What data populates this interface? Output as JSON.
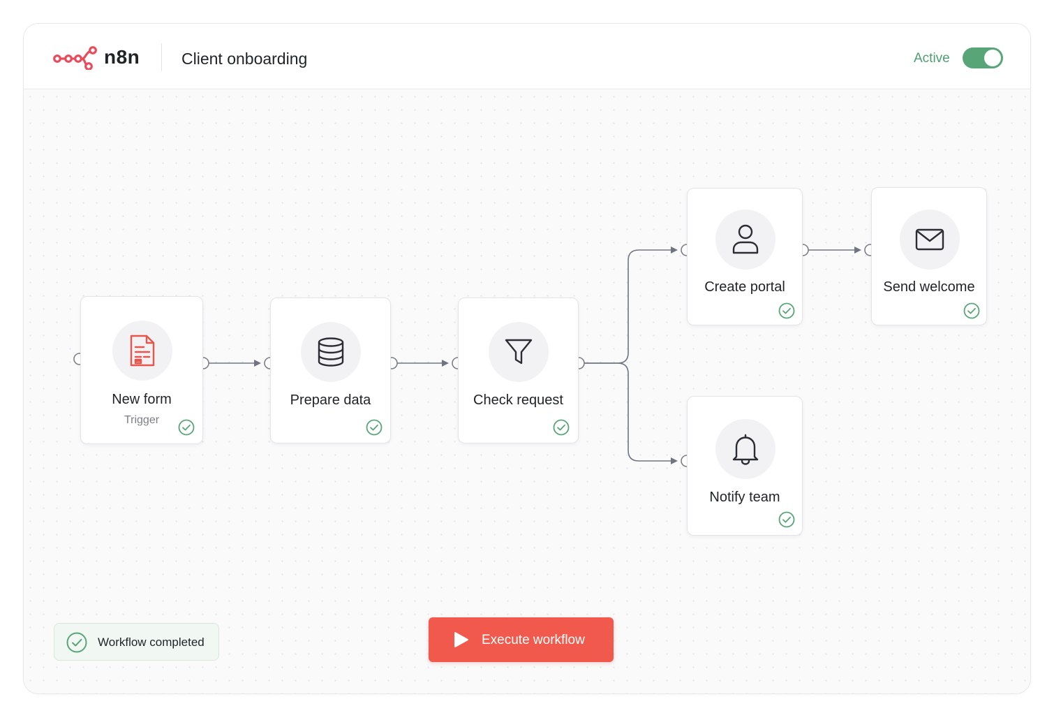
{
  "app": {
    "brand": "n8n",
    "workflow_title": "Client onboarding",
    "active_label": "Active",
    "active": true
  },
  "nodes": [
    {
      "id": "new-form",
      "title": "New form",
      "subtitle": "Trigger",
      "icon": "form-document-icon",
      "status": "success"
    },
    {
      "id": "prepare-data",
      "title": "Prepare data",
      "icon": "database-icon",
      "status": "success"
    },
    {
      "id": "check-request",
      "title": "Check request",
      "icon": "filter-funnel-icon",
      "status": "success"
    },
    {
      "id": "create-portal",
      "title": "Create portal",
      "icon": "user-icon",
      "status": "success"
    },
    {
      "id": "send-welcome",
      "title": "Send welcome",
      "icon": "mail-icon",
      "status": "success"
    },
    {
      "id": "notify-team",
      "title": "Notify team",
      "icon": "bell-icon",
      "status": "success"
    }
  ],
  "connections": [
    [
      "new-form",
      "prepare-data"
    ],
    [
      "prepare-data",
      "check-request"
    ],
    [
      "check-request",
      "create-portal"
    ],
    [
      "check-request",
      "notify-team"
    ],
    [
      "create-portal",
      "send-welcome"
    ]
  ],
  "footer": {
    "status_text": "Workflow completed",
    "execute_label": "Execute workflow"
  },
  "colors": {
    "brand": "#ea4b5a",
    "success": "#58a578",
    "execute": "#f0594b",
    "connector": "#6f7480"
  }
}
